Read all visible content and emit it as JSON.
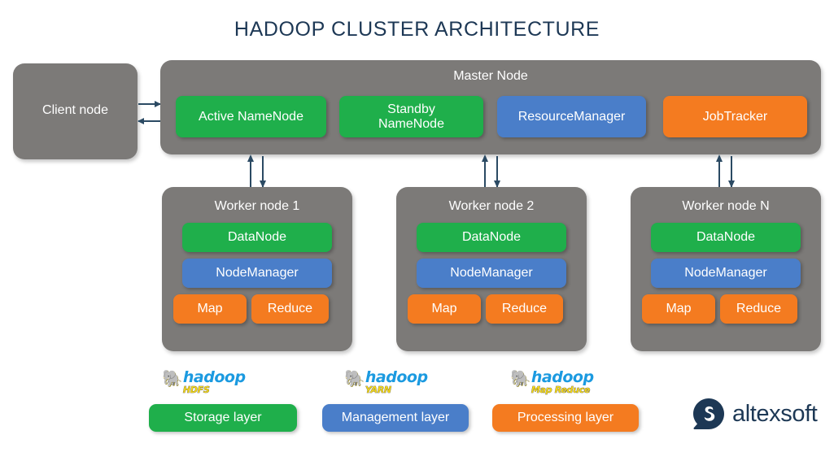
{
  "title": "HADOOP CLUSTER ARCHITECTURE",
  "colors": {
    "title": "#1d3855",
    "container_grey": "#7c7a78",
    "green": "#1faf4b",
    "blue": "#4a7ec9",
    "orange": "#f47b20",
    "arrow": "#2b4a63",
    "background": "#ffffff"
  },
  "client_node": {
    "label": "Client node"
  },
  "master_node": {
    "label": "Master Node",
    "components": [
      {
        "label": "Active NameNode",
        "color": "green"
      },
      {
        "label": "Standby\nNameNode",
        "color": "green"
      },
      {
        "label": "ResourceManager",
        "color": "blue"
      },
      {
        "label": "JobTracker",
        "color": "orange"
      }
    ]
  },
  "worker_nodes": [
    {
      "label": "Worker node 1",
      "components": [
        {
          "label": "DataNode",
          "color": "green"
        },
        {
          "label": "NodeManager",
          "color": "blue"
        },
        {
          "label": "Map",
          "color": "orange"
        },
        {
          "label": "Reduce",
          "color": "orange"
        }
      ]
    },
    {
      "label": "Worker node 2",
      "components": [
        {
          "label": "DataNode",
          "color": "green"
        },
        {
          "label": "NodeManager",
          "color": "blue"
        },
        {
          "label": "Map",
          "color": "orange"
        },
        {
          "label": "Reduce",
          "color": "orange"
        }
      ]
    },
    {
      "label": "Worker node N",
      "components": [
        {
          "label": "DataNode",
          "color": "green"
        },
        {
          "label": "NodeManager",
          "color": "blue"
        },
        {
          "label": "Map",
          "color": "orange"
        },
        {
          "label": "Reduce",
          "color": "orange"
        }
      ]
    }
  ],
  "legend": [
    {
      "logo_name": "hadoop",
      "logo_sub": "HDFS",
      "label": "Storage layer",
      "color": "green"
    },
    {
      "logo_name": "hadoop",
      "logo_sub": "YARN",
      "label": "Management layer",
      "color": "blue"
    },
    {
      "logo_name": "hadoop",
      "logo_sub": "Map Reduce",
      "label": "Processing layer",
      "color": "orange"
    }
  ],
  "brand": {
    "name": "altexsoft"
  }
}
